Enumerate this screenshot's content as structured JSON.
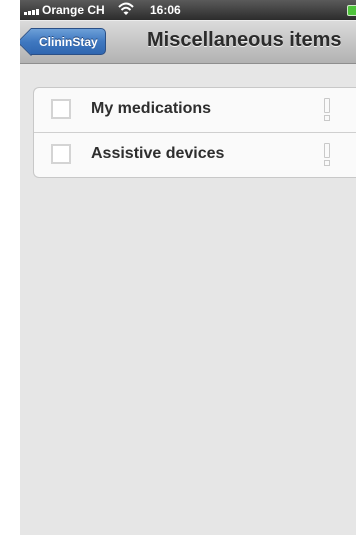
{
  "status_bar": {
    "carrier": "Orange CH",
    "time": "16:06",
    "battery_color": "#4ec33b"
  },
  "nav_bar": {
    "back_label": "ClininStay",
    "title": "Miscellaneous items"
  },
  "list": {
    "items": [
      {
        "label": "My medications",
        "checked": false,
        "icon": "exclamation-icon"
      },
      {
        "label": "Assistive devices",
        "checked": false,
        "icon": "exclamation-icon"
      }
    ]
  },
  "colors": {
    "accent": "#3f78c0",
    "background": "#e6e6e6"
  }
}
